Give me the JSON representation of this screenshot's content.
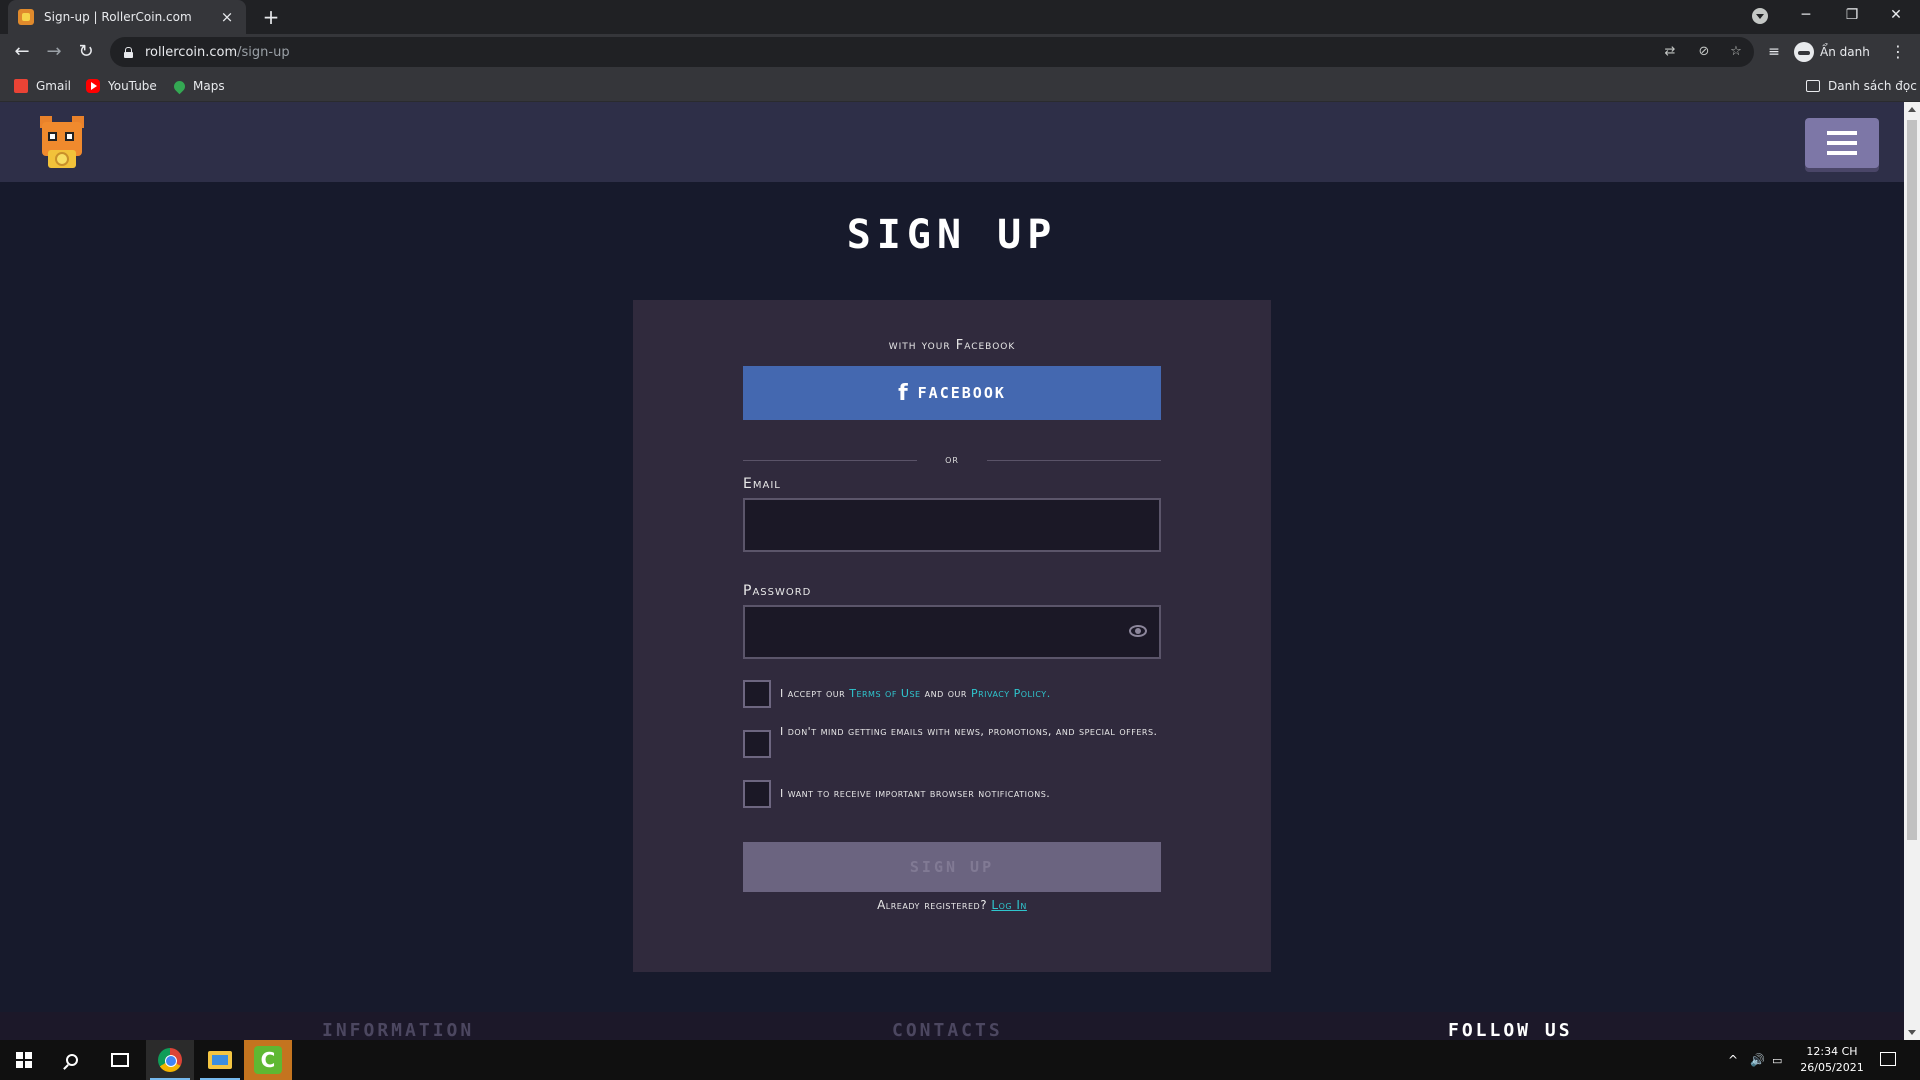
{
  "browser": {
    "tab_title": "Sign-up | RollerCoin.com",
    "tab_close": "×",
    "new_tab": "+",
    "url_host": "rollercoin.com",
    "url_path": "/sign-up",
    "profile_label": "Ẩn danh",
    "reading_list": "Danh sách đọc",
    "bookmarks": [
      {
        "label": "Gmail"
      },
      {
        "label": "YouTube"
      },
      {
        "label": "Maps"
      }
    ]
  },
  "page": {
    "title": "SIGN UP",
    "facebook_caption": "with your Facebook",
    "facebook_button": "FACEBOOK",
    "facebook_icon": "f",
    "or_text": "or",
    "email_label": "Email",
    "email_value": "",
    "password_label": "Password",
    "password_value": "",
    "terms_prefix": "I accept our ",
    "terms_link": "Terms of Use",
    "terms_mid": " and our ",
    "privacy_link": "Privacy Policy",
    "terms_suffix": ".",
    "emails_consent": "I don't mind getting emails with news, promotions, and special offers.",
    "notifications_consent": "I want to receive important browser notifications.",
    "signup_button": "SIGN UP",
    "already_text": "Already registered? ",
    "login_link": "Log In"
  },
  "footer": {
    "information": "INFORMATION",
    "contacts": "CONTACTS",
    "follow_us": "FOLLOW US"
  },
  "taskbar": {
    "time": "12:34 CH",
    "date": "26/05/2021"
  },
  "colors": {
    "page_bg": "#171a2c",
    "header_bg": "#2e2f48",
    "card_bg": "#302a3d",
    "facebook_blue": "#4468b0",
    "link_cyan": "#2fc6ce",
    "signup_disabled": "#6b6480"
  }
}
